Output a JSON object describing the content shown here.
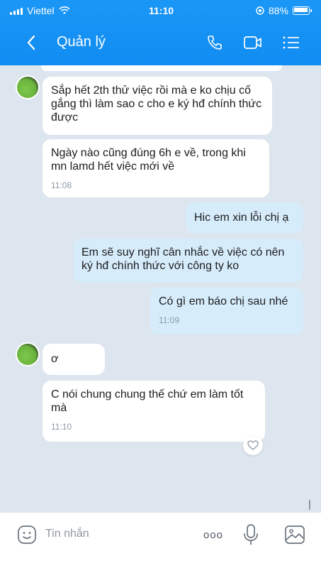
{
  "status_bar": {
    "carrier": "Viettel",
    "time": "11:10",
    "battery": "88%"
  },
  "header": {
    "title": "Quản lý"
  },
  "messages": [
    {
      "sender": "other",
      "text": "Sắp hết 2th thử việc rồi mà e ko chịu cố gắng thì làm sao c cho e ký hđ chính thức được",
      "time": ""
    },
    {
      "sender": "other",
      "text": "Ngày nào cũng đúng 6h e về, trong khi mn lamd hết việc mới về",
      "time": "11:08"
    },
    {
      "sender": "me",
      "text": "Hic em xin lỗi chị ạ",
      "time": ""
    },
    {
      "sender": "me",
      "text": "Em sẽ suy nghĩ cân nhắc về việc có nên ký hđ chính thức với công ty ko",
      "time": ""
    },
    {
      "sender": "me",
      "text": "Có gì em báo chị sau nhé",
      "time": "11:09"
    },
    {
      "sender": "other",
      "text": "ơ",
      "time": ""
    },
    {
      "sender": "other",
      "text": "C nói chung chung thế chứ em làm tốt mà",
      "time": "11:10"
    }
  ],
  "input": {
    "placeholder": "Tin nhắn",
    "more_label": "ooo"
  },
  "colors": {
    "header_blue": "#118cf2",
    "my_bubble": "#d7ecfb",
    "their_bubble": "#ffffff",
    "chat_bg": "#dde5ee"
  },
  "icons": {
    "back": "chevron-left-icon",
    "call": "phone-icon",
    "video": "video-camera-icon",
    "menu": "list-menu-icon",
    "emoji": "emoji-icon",
    "mic": "microphone-icon",
    "gallery": "image-icon",
    "reaction": "heart-icon"
  }
}
